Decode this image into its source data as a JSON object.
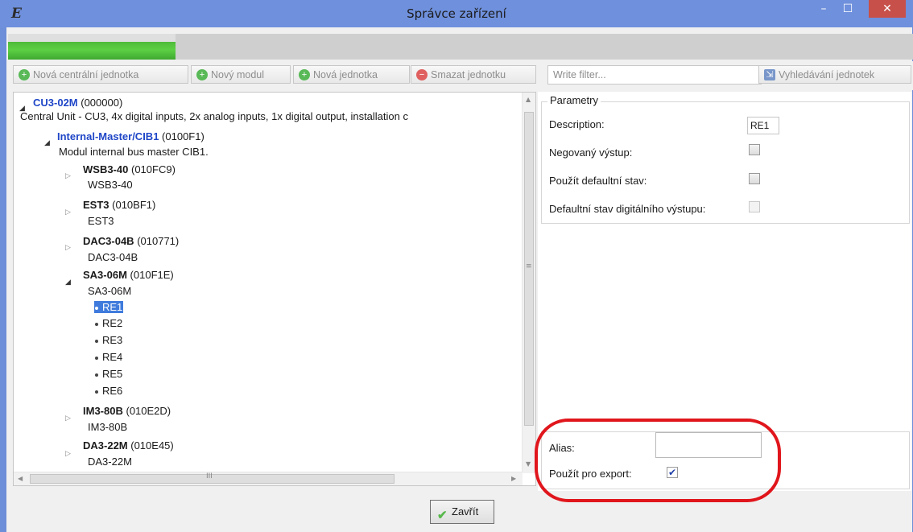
{
  "window": {
    "title": "Správce zařízení",
    "app_icon": "E",
    "min_glyph": "–",
    "max_glyph": "☐",
    "close_glyph": "✕"
  },
  "progress": {
    "fraction": 0.185
  },
  "toolbar": {
    "new_central": "Nová centrální jednotka",
    "new_module": "Nový modul",
    "new_unit": "Nová jednotka",
    "delete_unit": "Smazat jednotku",
    "filter_placeholder": "Write filter...",
    "search_units": "Vyhledávání jednotek",
    "plus_glyph": "+",
    "minus_glyph": "−",
    "search_glyph": "⇲"
  },
  "tree": {
    "arrow_open": "◢",
    "arrow_closed": "▷",
    "cu": {
      "name": "CU3-02M",
      "code": "(000000)",
      "desc": "Central Unit - CU3, 4x digital inputs, 2x analog inputs, 1x digital output, installation c"
    },
    "master": {
      "name": "Internal-Master/CIB1",
      "code": "(0100F1)",
      "desc": "Modul internal bus master CIB1."
    },
    "modules": [
      {
        "name": "WSB3-40",
        "code": "(010FC9)",
        "sub": "WSB3-40"
      },
      {
        "name": "EST3",
        "code": "(010BF1)",
        "sub": "EST3"
      },
      {
        "name": "DAC3-04B",
        "code": "(010771)",
        "sub": "DAC3-04B"
      },
      {
        "name": "SA3-06M",
        "code": "(010F1E)",
        "sub": "SA3-06M"
      },
      {
        "name": "IM3-80B",
        "code": "(010E2D)",
        "sub": "IM3-80B"
      },
      {
        "name": "DA3-22M",
        "code": "(010E45)",
        "sub": "DA3-22M"
      }
    ],
    "outputs": [
      "RE1",
      "RE2",
      "RE3",
      "RE4",
      "RE5",
      "RE6"
    ],
    "hscroll_grip": "III",
    "vscroll_grip": "≡",
    "scroll_up": "▲",
    "scroll_down": "▼",
    "scroll_left": "◀",
    "scroll_right": "▶"
  },
  "params": {
    "group_title": "Parametry",
    "description_label": "Description:",
    "description_value": "RE1",
    "negated_label": "Negovaný výstup:",
    "use_default_label": "Použít defaultní stav:",
    "default_state_label": "Defaultní stav digitálního výstupu:",
    "alias_label": "Alias:",
    "alias_value": "",
    "export_label": "Použít pro export:",
    "export_check_glyph": "✔"
  },
  "footer": {
    "close_label": "Zavřít",
    "check_glyph": "✔"
  },
  "colors": {
    "title_bar": "#6f90dc",
    "selection": "#3f7bdc",
    "highlight_ring": "#e0161c",
    "link_blue": "#1f46c7"
  }
}
